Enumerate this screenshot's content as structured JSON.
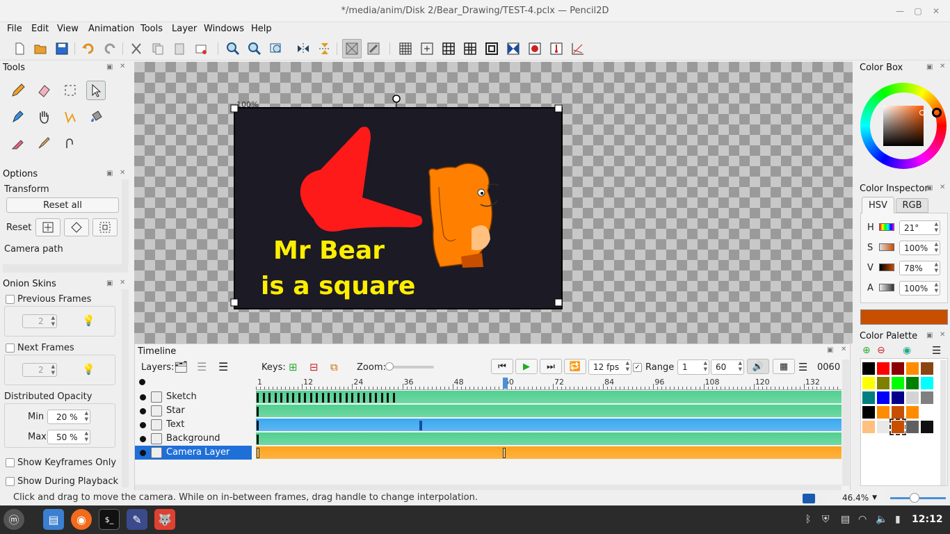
{
  "window": {
    "title": "*/media/anim/Disk 2/Bear_Drawing/TEST-4.pclx — Pencil2D"
  },
  "menu": [
    "File",
    "Edit",
    "View",
    "Animation",
    "Tools",
    "Layer",
    "Windows",
    "Help"
  ],
  "toolbar_icons": [
    "new-file-icon",
    "open-folder-icon",
    "save-icon",
    "undo-icon",
    "redo-icon",
    "cut-icon",
    "copy-icon",
    "paste-icon",
    "clear-icon",
    "zoom-in-icon",
    "zoom-out-icon",
    "zoom-fit-icon",
    "flip-horizontal-icon",
    "flip-vertical-icon",
    "onion-skin-icon",
    "light-table-icon",
    "grid-icon",
    "center-guide-icon",
    "thirds-guide-icon",
    "golden-ratio-icon",
    "safe-area-icon",
    "flip-guide-icon",
    "camera-overlay-icon",
    "perspective-icon",
    "perspective-3-icon"
  ],
  "tools_panel": {
    "title": "Tools"
  },
  "options_panel": {
    "title": "Options",
    "section": "Transform",
    "reset_all": "Reset all",
    "reset_label": "Reset",
    "camera_path": "Camera path"
  },
  "onion_panel": {
    "title": "Onion Skins",
    "previous_frames": "Previous Frames",
    "prev_value": "2",
    "next_frames": "Next Frames",
    "next_value": "2",
    "dist_opacity": "Distributed Opacity",
    "min_label": "Min",
    "min_value": "20 %",
    "max_label": "Max",
    "max_value": "50 %",
    "keyframes_only": "Show Keyframes Only",
    "during_playback": "Show During Playback"
  },
  "canvas": {
    "zoom_label": "100%",
    "text_line1": "Mr Bear",
    "text_line2": "is a square",
    "background_color": "#1c1a24",
    "text_color": "#ffee00",
    "shape_color": "#ff1a1a",
    "bear_color": "#ff7f00"
  },
  "timeline": {
    "title": "Timeline",
    "layers_label": "Layers:",
    "keys_label": "Keys:",
    "zoom_label": "Zoom:",
    "fps": "12 fps",
    "range_label": "Range",
    "range_start": "1",
    "range_end": "60",
    "frame_counter": "0060",
    "ruler": [
      "1",
      "12",
      "24",
      "36",
      "48",
      "60",
      "72",
      "84",
      "96",
      "108",
      "120",
      "132"
    ],
    "layers": [
      {
        "name": "Sketch",
        "color": "#50d090"
      },
      {
        "name": "Star",
        "color": "#50d090"
      },
      {
        "name": "Text",
        "color": "#3aa8f0"
      },
      {
        "name": "Background",
        "color": "#50d090"
      },
      {
        "name": "Camera Layer",
        "color": "#ffa31a",
        "selected": true
      }
    ]
  },
  "color_box": {
    "title": "Color Box"
  },
  "color_inspector": {
    "title": "Color Inspector",
    "tab_hsv": "HSV",
    "tab_rgb": "RGB",
    "h_label": "H",
    "h_value": "21°",
    "s_label": "S",
    "s_value": "100%",
    "v_label": "V",
    "v_value": "78%",
    "a_label": "A",
    "a_value": "100%",
    "current_color": "#c84e00"
  },
  "color_palette": {
    "title": "Color Palette",
    "swatches": [
      "#000000",
      "#ff0000",
      "#8b0000",
      "#ff8c00",
      "#8b4513",
      "#ffff00",
      "#808000",
      "#00ff00",
      "#008000",
      "#00ffff",
      "#008080",
      "#0000ff",
      "#00008b",
      "#d3d3d3",
      "#808080",
      "#000000",
      "#ff8c00",
      "#c84e00",
      "#ff8c00",
      "#ffffff",
      "#ffc080",
      "#e8e8e8",
      "#c84e00",
      "#606060",
      "#101010"
    ]
  },
  "status": {
    "message": "Click and drag to move the camera. While on in-between frames, drag handle to change interpolation.",
    "zoom": "46.4%"
  },
  "taskbar": {
    "clock": "12:12"
  }
}
